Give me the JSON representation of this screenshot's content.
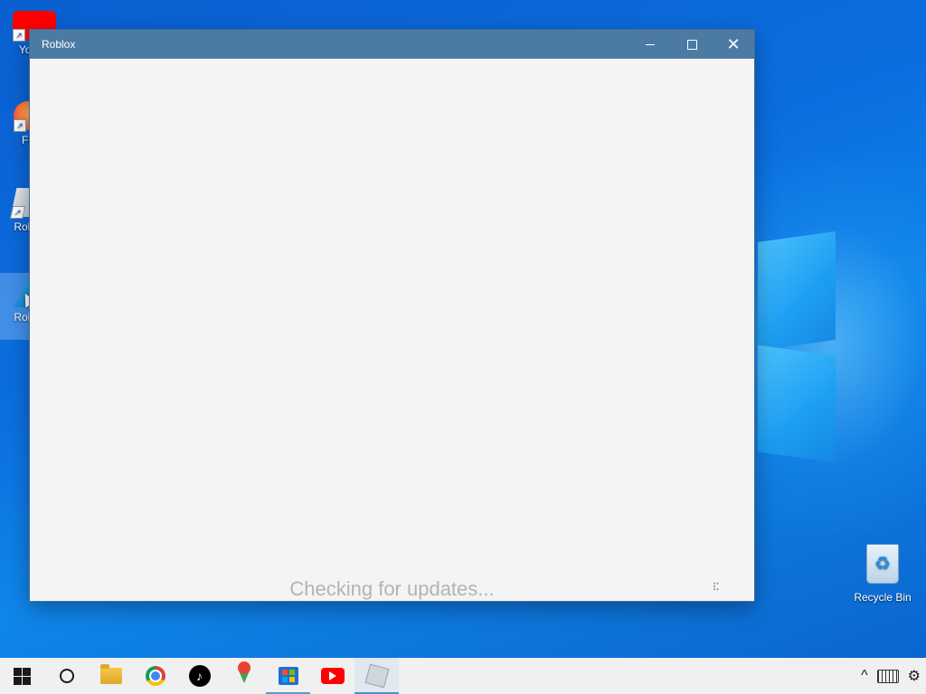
{
  "desktop": {
    "icons": [
      {
        "label": "You",
        "type": "youtube"
      },
      {
        "label": "Fir",
        "type": "firefox"
      },
      {
        "label": "Roblo",
        "type": "roblox"
      },
      {
        "label": "Roblo",
        "type": "roblox-studio",
        "selected": true
      }
    ],
    "recycle_bin_label": "Recycle Bin"
  },
  "window": {
    "title": "Roblox",
    "controls": {
      "minimize": "minimize-icon",
      "maximize": "maximize-icon",
      "close": "close-icon"
    },
    "status_text": "Checking for updates..."
  },
  "taskbar": {
    "items": [
      {
        "name": "start",
        "icon": "windows-logo-icon"
      },
      {
        "name": "search",
        "icon": "cortana-icon"
      },
      {
        "name": "file-explorer",
        "icon": "folder-icon"
      },
      {
        "name": "chrome",
        "icon": "chrome-icon"
      },
      {
        "name": "tiktok",
        "icon": "tiktok-icon"
      },
      {
        "name": "maps",
        "icon": "maps-pin-icon"
      },
      {
        "name": "store",
        "icon": "store-icon",
        "running": true
      },
      {
        "name": "youtube",
        "icon": "youtube-icon"
      },
      {
        "name": "roblox",
        "icon": "roblox-icon",
        "active": true
      }
    ],
    "tray": {
      "chevron": "^",
      "keyboard_icon": "keyboard-icon",
      "settings_icon": "gear-icon"
    }
  },
  "colors": {
    "titlebar": "#4b7aa3",
    "window_bg": "#f4f4f4",
    "status_text": "#b3b3b3"
  }
}
